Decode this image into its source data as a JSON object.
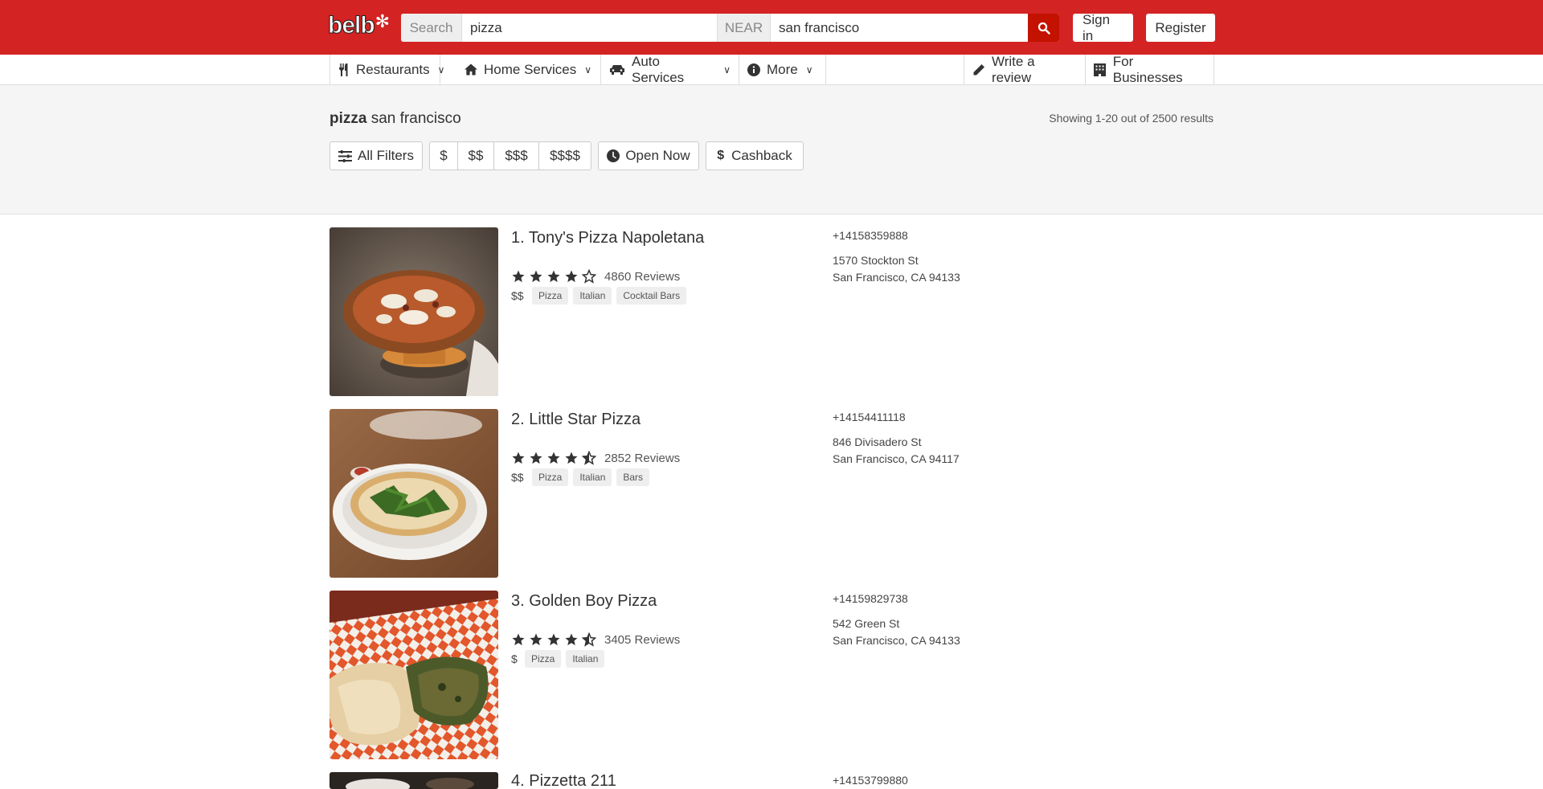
{
  "header": {
    "logo_text": "belb",
    "search_label": "Search",
    "search_value": "pizza",
    "near_label": "NEAR",
    "near_value": "san francisco",
    "signin_label": "Sign in",
    "register_label": "Register",
    "brand_color": "#d32323"
  },
  "nav": {
    "items": [
      {
        "label": "Restaurants",
        "icon": "utensils-icon"
      },
      {
        "label": "Home Services",
        "icon": "home-icon"
      },
      {
        "label": "Auto Services",
        "icon": "car-icon"
      },
      {
        "label": "More",
        "icon": "info-icon"
      }
    ],
    "write_review": "Write a review",
    "for_businesses": "For Businesses"
  },
  "query": {
    "term": "pizza",
    "location": "san francisco",
    "result_count": "Showing 1-20 out of 2500 results"
  },
  "filters": {
    "all_filters": "All Filters",
    "prices": [
      "$",
      "$$",
      "$$$",
      "$$$$"
    ],
    "open_now": "Open Now",
    "cashback": "Cashback"
  },
  "results": [
    {
      "name": "1. Tony's Pizza Napoletana",
      "rating": 4,
      "reviews": "4860 Reviews",
      "price": "$$",
      "tags": [
        "Pizza",
        "Italian",
        "Cocktail Bars"
      ],
      "phone": "+14158359888",
      "address1": "1570 Stockton St",
      "address2": "San Francisco, CA 94133"
    },
    {
      "name": "2. Little Star Pizza",
      "rating": 4.5,
      "reviews": "2852 Reviews",
      "price": "$$",
      "tags": [
        "Pizza",
        "Italian",
        "Bars"
      ],
      "phone": "+14154411118",
      "address1": "846 Divisadero St",
      "address2": "San Francisco, CA 94117"
    },
    {
      "name": "3. Golden Boy Pizza",
      "rating": 4.5,
      "reviews": "3405 Reviews",
      "price": "$",
      "tags": [
        "Pizza",
        "Italian"
      ],
      "phone": "+14159829738",
      "address1": "542 Green St",
      "address2": "San Francisco, CA 94133"
    },
    {
      "name": "4. Pizzetta 211",
      "phone": "+14153799880"
    }
  ]
}
